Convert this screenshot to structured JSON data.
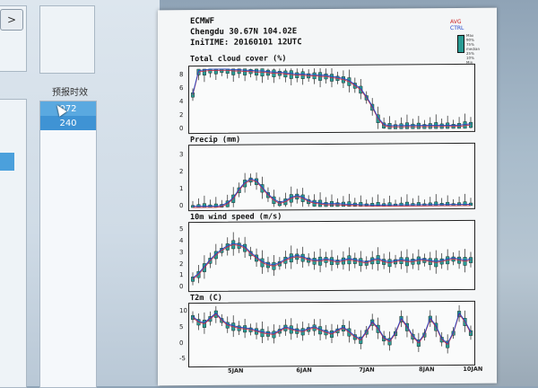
{
  "left": {
    "button_label": ">",
    "column_header": "预报时效",
    "list_values": [
      "072",
      "240"
    ]
  },
  "sheet": {
    "source": "ECMWF",
    "location": "Chengdu 30.67N 104.02E",
    "init_time": "IniTIME: 20160101 12UTC",
    "legend": {
      "avg": "AVG",
      "ctrl": "CTRL",
      "stats": [
        "Max",
        "90%",
        "75%",
        "median",
        "25%",
        "10%",
        "Min"
      ]
    }
  },
  "panels": [
    {
      "title": "Total cloud cover (%)",
      "yticks": [
        "0",
        "2",
        "4",
        "6",
        "8"
      ]
    },
    {
      "title": "Precip (mm)",
      "yticks": [
        "0",
        "1",
        "2",
        "3"
      ]
    },
    {
      "title": "10m wind speed (m/s)",
      "yticks": [
        "0",
        "1",
        "2",
        "3",
        "4",
        "5"
      ]
    },
    {
      "title": "T2m (C)",
      "yticks": [
        "-5",
        "0",
        "5",
        "10"
      ]
    }
  ],
  "xticks": [
    "5JAN",
    "6JAN",
    "7JAN",
    "8JAN",
    "10JAN"
  ],
  "colors": {
    "box_fill": "#2a9c95",
    "avg_line": "#c2334a",
    "ctrl_line": "#2346c4",
    "whisker": "#222222"
  },
  "chart_data": [
    {
      "type": "line",
      "title": "Total cloud cover (%)",
      "ylim": [
        0,
        9
      ],
      "series": [
        {
          "name": "AVG",
          "values": [
            5.2,
            8.6,
            8.7,
            8.8,
            8.8,
            8.8,
            8.8,
            8.7,
            8.7,
            8.6,
            8.6,
            8.5,
            8.5,
            8.4,
            8.3,
            8.3,
            8.2,
            8.1,
            8.0,
            8.0,
            7.9,
            7.9,
            7.8,
            7.8,
            7.6,
            7.5,
            7.3,
            7.0,
            6.4,
            5.8,
            4.6,
            3.2,
            1.5,
            0.5,
            0.3,
            0.3,
            0.3,
            0.3,
            0.3,
            0.3,
            0.3,
            0.3,
            0.3,
            0.3,
            0.3,
            0.3,
            0.3,
            0.4,
            0.5
          ]
        }
      ]
    },
    {
      "type": "line",
      "title": "Precip (mm)",
      "ylim": [
        0,
        3.5
      ],
      "series": [
        {
          "name": "AVG",
          "values": [
            0,
            0,
            0,
            0,
            0,
            0.05,
            0.2,
            0.5,
            1.0,
            1.4,
            1.6,
            1.5,
            1.1,
            0.7,
            0.4,
            0.2,
            0.3,
            0.5,
            0.6,
            0.5,
            0.3,
            0.2,
            0.15,
            0.1,
            0.1,
            0.1,
            0.08,
            0.05,
            0.05,
            0.03,
            0.02,
            0,
            0,
            0,
            0,
            0,
            0,
            0,
            0,
            0,
            0,
            0,
            0,
            0,
            0,
            0,
            0,
            0,
            0
          ]
        }
      ]
    },
    {
      "type": "line",
      "title": "10m wind speed (m/s)",
      "ylim": [
        0,
        5.5
      ],
      "series": [
        {
          "name": "AVG",
          "values": [
            0.8,
            1.2,
            1.8,
            2.4,
            2.9,
            3.3,
            3.6,
            3.8,
            3.7,
            3.5,
            3.0,
            2.6,
            2.2,
            2.0,
            1.9,
            2.1,
            2.4,
            2.6,
            2.7,
            2.6,
            2.4,
            2.3,
            2.3,
            2.4,
            2.3,
            2.2,
            2.3,
            2.4,
            2.3,
            2.2,
            2.1,
            2.3,
            2.4,
            2.2,
            2.1,
            2.2,
            2.3,
            2.2,
            2.2,
            2.3,
            2.3,
            2.2,
            2.1,
            2.2,
            2.3,
            2.4,
            2.3,
            2.2,
            2.3
          ]
        }
      ]
    },
    {
      "type": "line",
      "title": "T2m (C)",
      "ylim": [
        -6,
        12
      ],
      "series": [
        {
          "name": "AVG",
          "values": [
            8.5,
            7.0,
            6.5,
            8.0,
            9.5,
            7.5,
            6.0,
            5.5,
            5.0,
            4.8,
            4.5,
            4.0,
            3.5,
            3.2,
            3.0,
            4.0,
            5.0,
            4.5,
            4.0,
            3.8,
            4.5,
            5.0,
            4.2,
            3.5,
            3.0,
            4.0,
            4.8,
            3.5,
            2.0,
            1.0,
            3.5,
            6.5,
            4.5,
            1.5,
            0.5,
            3.0,
            7.5,
            5.0,
            2.0,
            0.0,
            2.5,
            7.5,
            5.0,
            1.0,
            -0.5,
            3.0,
            9.0,
            6.5,
            3.0
          ]
        }
      ]
    }
  ]
}
